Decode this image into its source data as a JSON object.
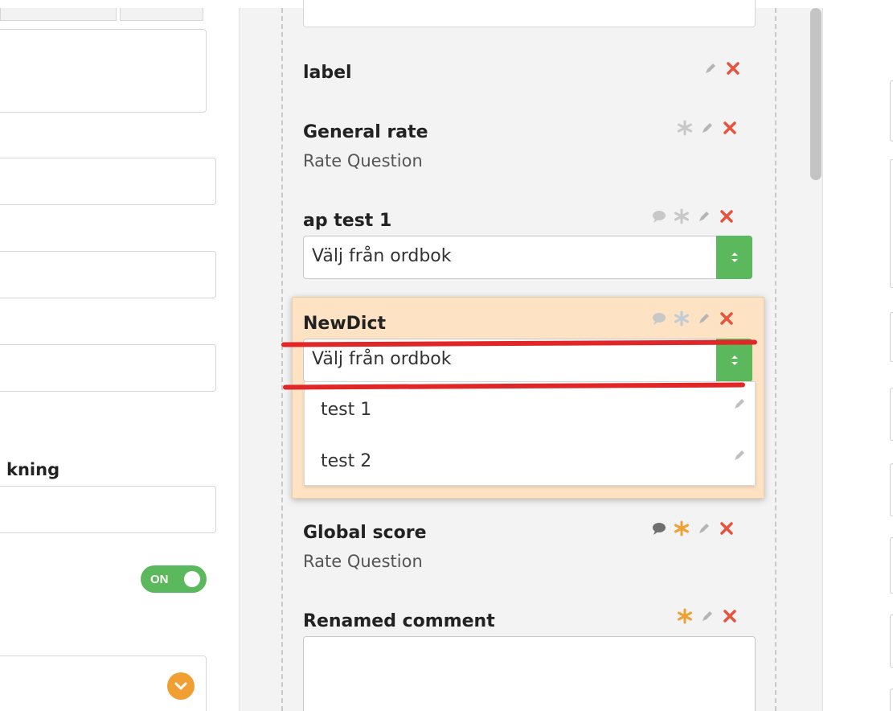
{
  "left_panel": {
    "partial_label": "kning",
    "toggle_label": "ON",
    "dropdown_icon": "chevron-down-icon"
  },
  "form_builder": {
    "questions": [
      {
        "title": "label",
        "subtitle": ""
      },
      {
        "title": "General rate",
        "subtitle": "Rate Question"
      },
      {
        "title": "ap test 1",
        "select_value": "Välj från ordbok"
      },
      {
        "title": "NewDict",
        "select_value": "Välj från ordbok",
        "options": [
          "test 1",
          "test 2"
        ]
      },
      {
        "title": "Global score",
        "subtitle": "Rate Question"
      },
      {
        "title": "Renamed comment"
      }
    ]
  },
  "colors": {
    "accent_green": "#5cb85c",
    "delete_red": "#e9533d",
    "star_orange": "#f0a033",
    "highlight_bg": "#fde3c3",
    "annotation_red": "#e02626"
  }
}
